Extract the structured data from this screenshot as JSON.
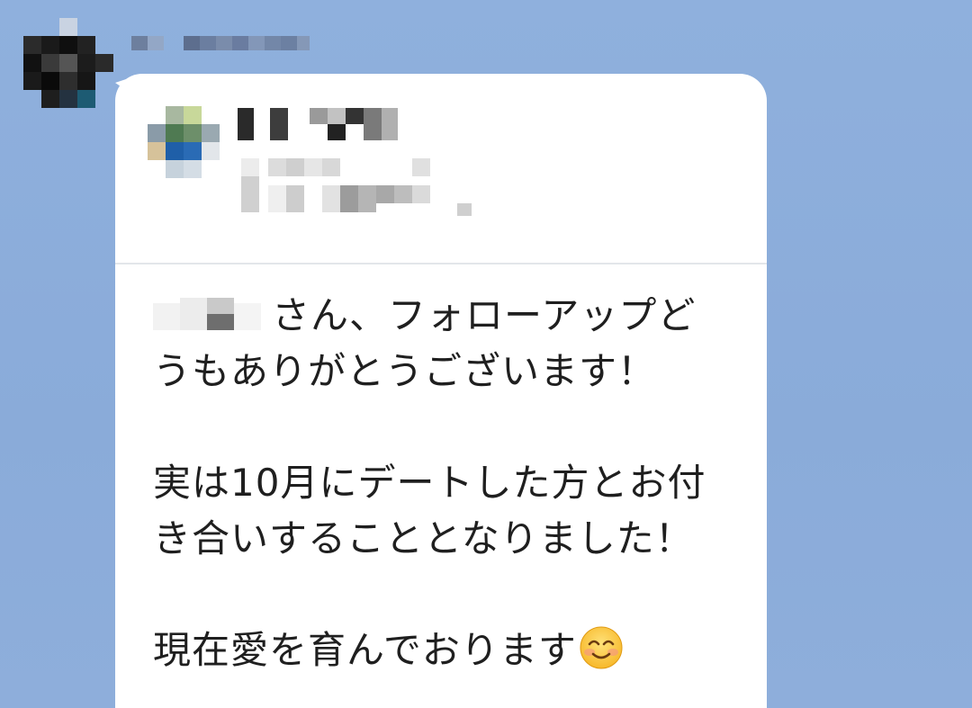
{
  "message": {
    "line1_suffix": "さん、フォローアップど",
    "line2": "うもありがとうございます！",
    "line3": "実は10月にデートした方とお付",
    "line4": "き合いすることとなりました！",
    "line5": "現在愛を育んでおります"
  },
  "icons": {
    "emoji": "smiling-face-icon",
    "sender_avatar": "avatar-redacted",
    "card_avatar": "avatar-redacted"
  },
  "colors": {
    "chat_background": "#8daddb",
    "bubble": "#ffffff",
    "text": "#1f1f1f",
    "divider": "#e3e6ea"
  }
}
